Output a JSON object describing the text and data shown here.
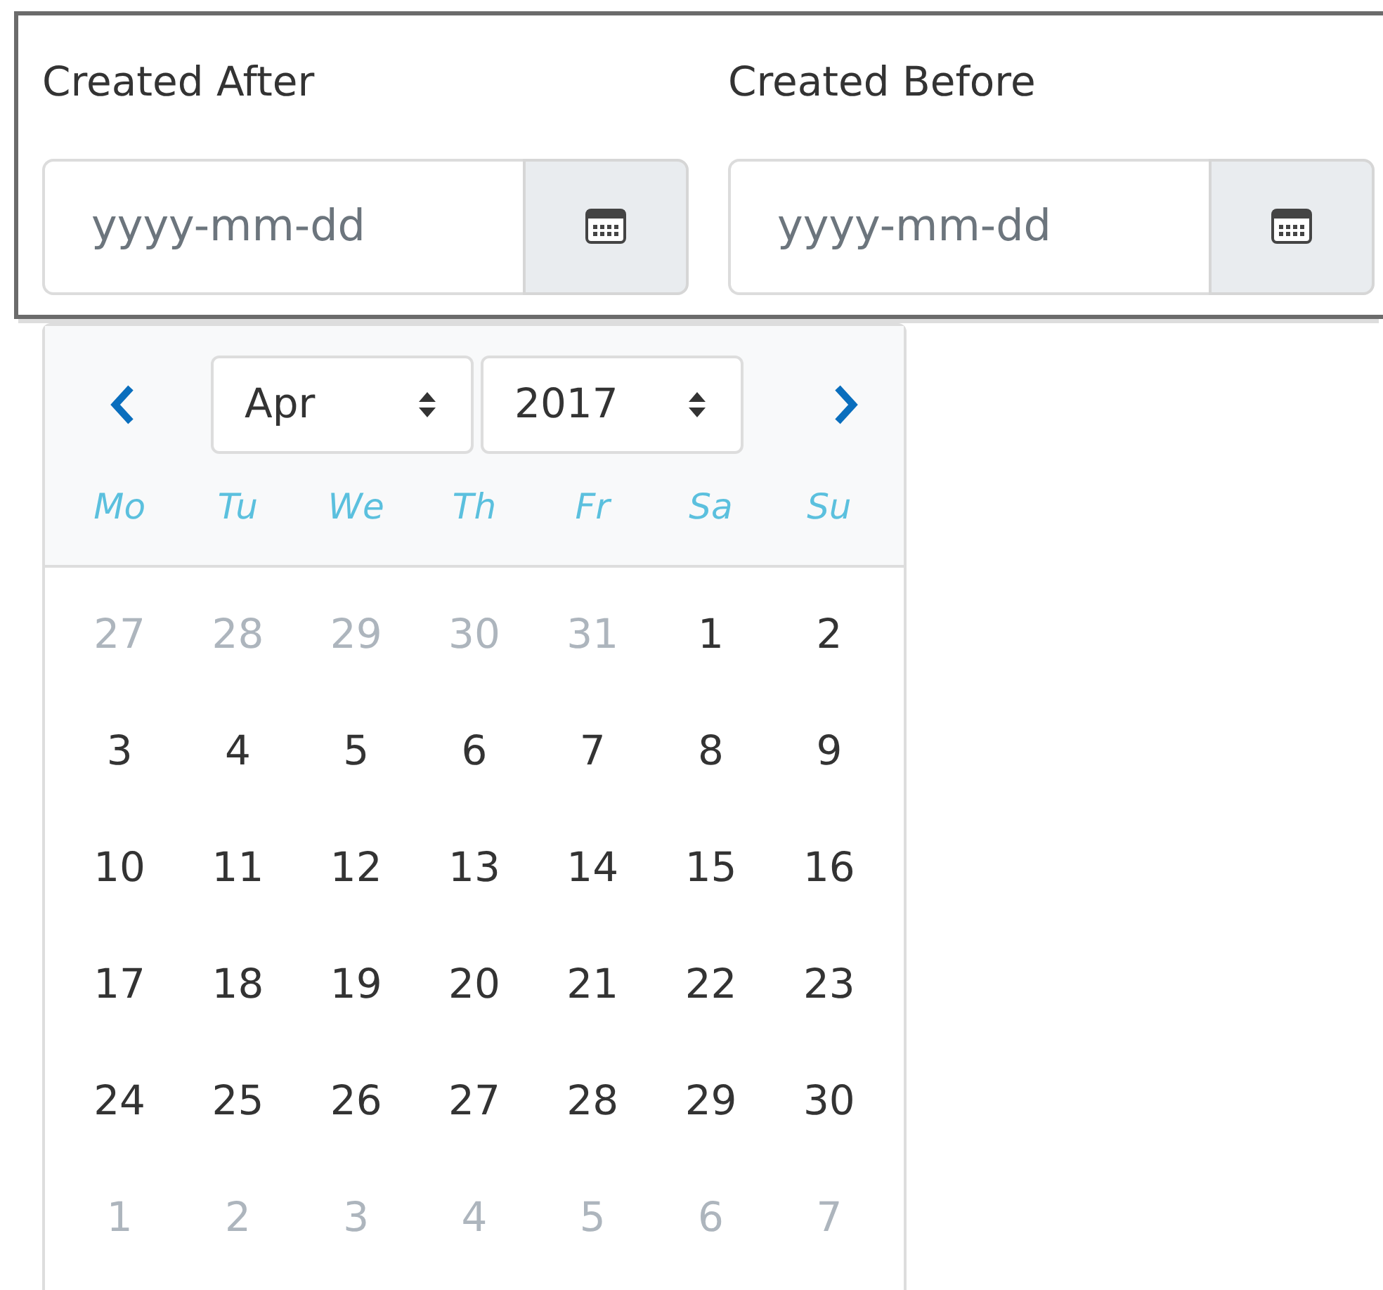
{
  "filters": [
    {
      "label": "Created After",
      "placeholder": "yyyy-mm-dd"
    },
    {
      "label": "Created Before",
      "placeholder": "yyyy-mm-dd"
    }
  ],
  "datepicker": {
    "month": "Apr",
    "year": "2017",
    "weekdays": [
      "Mo",
      "Tu",
      "We",
      "Th",
      "Fr",
      "Sa",
      "Su"
    ],
    "weeks": [
      [
        {
          "day": "27",
          "outside": true
        },
        {
          "day": "28",
          "outside": true
        },
        {
          "day": "29",
          "outside": true
        },
        {
          "day": "30",
          "outside": true
        },
        {
          "day": "31",
          "outside": true
        },
        {
          "day": "1",
          "outside": false
        },
        {
          "day": "2",
          "outside": false
        }
      ],
      [
        {
          "day": "3",
          "outside": false
        },
        {
          "day": "4",
          "outside": false
        },
        {
          "day": "5",
          "outside": false
        },
        {
          "day": "6",
          "outside": false
        },
        {
          "day": "7",
          "outside": false
        },
        {
          "day": "8",
          "outside": false
        },
        {
          "day": "9",
          "outside": false
        }
      ],
      [
        {
          "day": "10",
          "outside": false
        },
        {
          "day": "11",
          "outside": false
        },
        {
          "day": "12",
          "outside": false
        },
        {
          "day": "13",
          "outside": false
        },
        {
          "day": "14",
          "outside": false
        },
        {
          "day": "15",
          "outside": false
        },
        {
          "day": "16",
          "outside": false
        }
      ],
      [
        {
          "day": "17",
          "outside": false
        },
        {
          "day": "18",
          "outside": false
        },
        {
          "day": "19",
          "outside": false
        },
        {
          "day": "20",
          "outside": false
        },
        {
          "day": "21",
          "outside": false
        },
        {
          "day": "22",
          "outside": false
        },
        {
          "day": "23",
          "outside": false
        }
      ],
      [
        {
          "day": "24",
          "outside": false
        },
        {
          "day": "25",
          "outside": false
        },
        {
          "day": "26",
          "outside": false
        },
        {
          "day": "27",
          "outside": false
        },
        {
          "day": "28",
          "outside": false
        },
        {
          "day": "29",
          "outside": false
        },
        {
          "day": "30",
          "outside": false
        }
      ],
      [
        {
          "day": "1",
          "outside": true
        },
        {
          "day": "2",
          "outside": true
        },
        {
          "day": "3",
          "outside": true
        },
        {
          "day": "4",
          "outside": true
        },
        {
          "day": "5",
          "outside": true
        },
        {
          "day": "6",
          "outside": true
        },
        {
          "day": "7",
          "outside": true
        }
      ]
    ]
  }
}
